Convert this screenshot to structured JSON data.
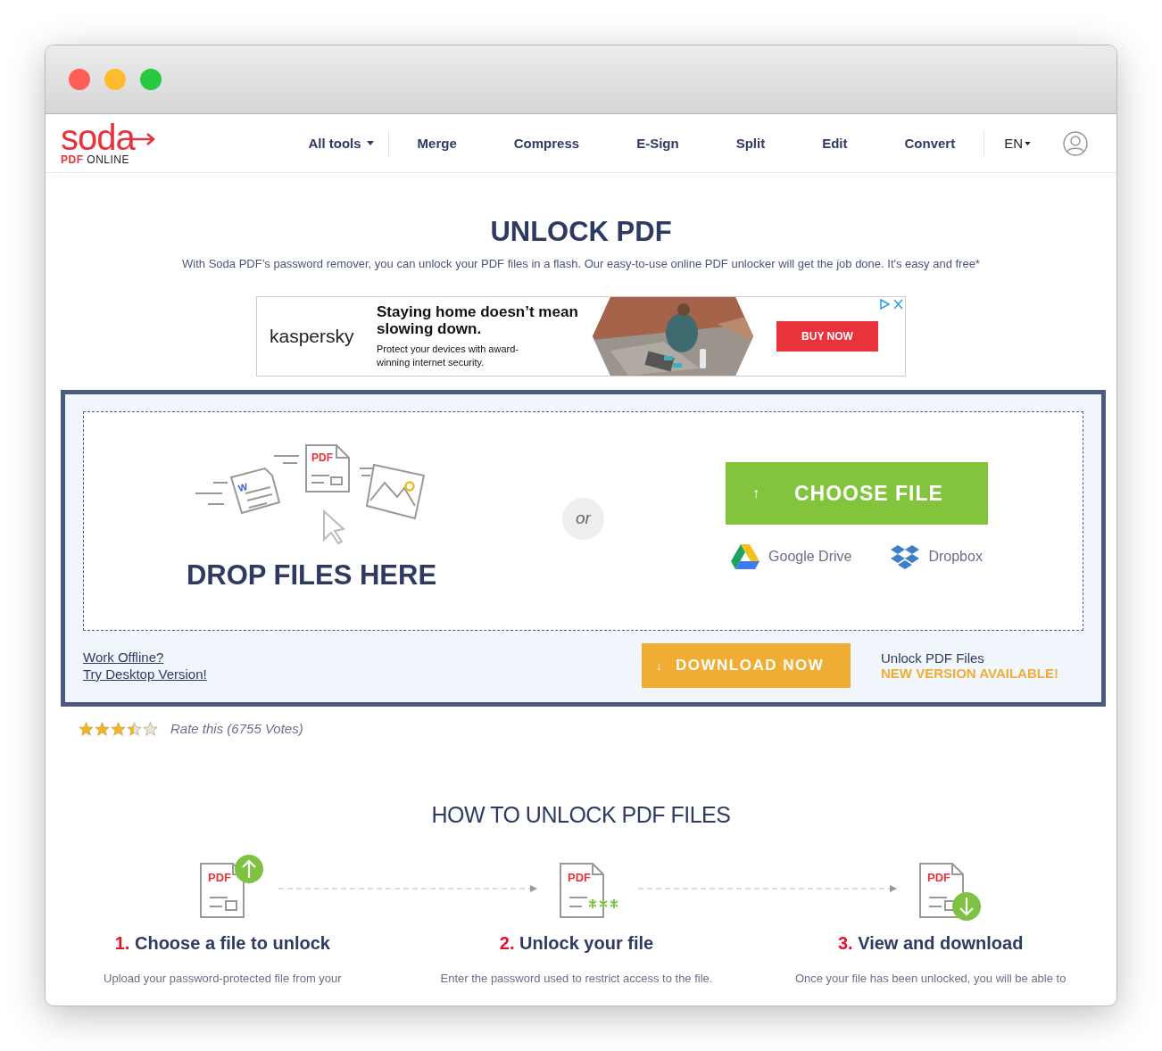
{
  "logo": {
    "word": "soda",
    "pdf": "PDF",
    "online": "ONLINE"
  },
  "nav": [
    {
      "label": "All tools",
      "dropdown": true
    },
    {
      "label": "Merge",
      "dropdown": false
    },
    {
      "label": "Compress",
      "dropdown": false
    },
    {
      "label": "E-Sign",
      "dropdown": false
    },
    {
      "label": "Split",
      "dropdown": false
    },
    {
      "label": "Edit",
      "dropdown": false
    },
    {
      "label": "Convert",
      "dropdown": false
    }
  ],
  "language": "EN",
  "title": "UNLOCK PDF",
  "subtitle": "With Soda PDF’s password remover, you can unlock your PDF files in a flash. Our easy-to-use online PDF unlocker will get the job done. It's easy and free*",
  "ad": {
    "brand": "kaspersky",
    "headline": "Staying home doesn’t mean slowing down.",
    "body": "Protect your devices with award-winning internet security.",
    "button": "BUY NOW"
  },
  "upload": {
    "drop_label": "DROP FILES HERE",
    "drawing_letters": {
      "doc": "W",
      "pdf": "PDF"
    },
    "choose_arrow": "↑",
    "download_arrow": "↓",
    "or": "or",
    "choose_button": "CHOOSE FILE",
    "sources": [
      {
        "kind": "drive",
        "label": "Google Drive"
      },
      {
        "kind": "dropbox",
        "label": "Dropbox"
      }
    ],
    "offline_links": [
      "Work Offline?",
      "Try Desktop Version!"
    ],
    "download_button": "DOWNLOAD NOW",
    "promo_title": "Unlock PDF Files",
    "promo_note": "NEW VERSION AVAILABLE!"
  },
  "rating": {
    "stars": 3.5,
    "label": "Rate this (6755 Votes)"
  },
  "howto": {
    "title": "HOW TO UNLOCK PDF FILES",
    "steps": [
      {
        "kind": "upload",
        "badge": "PDF",
        "number": "1.",
        "title": "Choose a file to unlock",
        "text": "Upload your password-protected file from your"
      },
      {
        "kind": "unlock",
        "badge": "PDF",
        "number": "2.",
        "title": "Unlock your file",
        "text": "Enter the password used to restrict access to the file."
      },
      {
        "kind": "download",
        "badge": "PDF",
        "number": "3.",
        "title": "View and download",
        "text": "Once your file has been unlocked, you will be able to"
      }
    ]
  }
}
